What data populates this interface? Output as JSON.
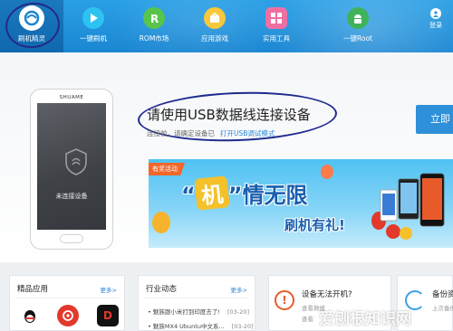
{
  "nav": {
    "items": [
      {
        "label": "刷机精灵",
        "icon": "app-logo-icon"
      },
      {
        "label": "一键刷机",
        "icon": "play-icon"
      },
      {
        "label": "ROM市场",
        "icon": "rom-icon"
      },
      {
        "label": "应用游戏",
        "icon": "bag-icon"
      },
      {
        "label": "实用工具",
        "icon": "grid-icon"
      },
      {
        "label": "一键Root",
        "icon": "android-icon"
      }
    ],
    "login_label": "登录"
  },
  "device": {
    "brand": "SHUAME",
    "status": "未连接设备"
  },
  "connect": {
    "title": "请使用USB数据线连接设备",
    "hint": "连接前，请确定设备已",
    "hint_link": "打开USB调试模式",
    "button": "立即"
  },
  "banner": {
    "tag": "有奖活动",
    "headline_ji": "机",
    "headline_rest": "情无限",
    "subline": "刷机有礼!",
    "quote_open": "“",
    "quote_close": "”"
  },
  "panels": {
    "apps": {
      "title": "精品应用",
      "more": "更多>",
      "icons": [
        "qq-icon",
        "netease-music-icon",
        "dapeei-icon"
      ],
      "icon_text": [
        "",
        "",
        "D"
      ]
    },
    "news": {
      "title": "行业动态",
      "more": "更多>",
      "items": [
        {
          "text": "魅族跟小米打到印度去了!",
          "date": "[03-20]"
        },
        {
          "text": "魅族MX4 Ubuntu中文系...",
          "date": "[03-20]"
        }
      ]
    },
    "boot": {
      "title": "设备无法开机?",
      "lines": [
        "查看救援",
        "查看"
      ]
    },
    "backup": {
      "title": "备份资",
      "line": "上次备份"
    }
  },
  "watermark": "爱刨根知识网"
}
